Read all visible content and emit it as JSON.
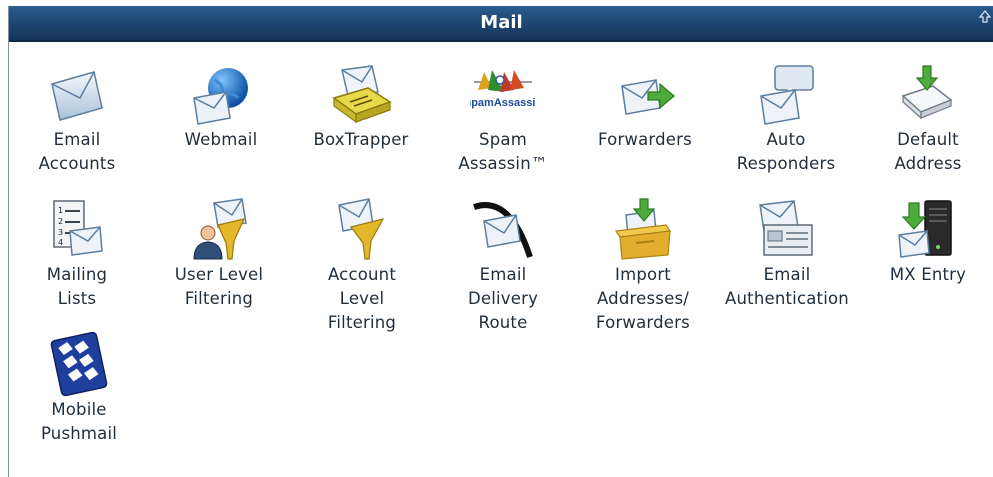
{
  "header": {
    "title": "Mail",
    "collapse_icon": "collapse-arrow-icon"
  },
  "items": [
    {
      "label": "Email\nAccounts",
      "icon": "envelope-icon"
    },
    {
      "label": "Webmail",
      "icon": "globe-envelope-icon"
    },
    {
      "label": "BoxTrapper",
      "icon": "box-trapper-icon"
    },
    {
      "label": "Spam\nAssassin™",
      "icon": "spamassassin-logo-icon",
      "logo_text": "SpamAssassin"
    },
    {
      "label": "Forwarders",
      "icon": "forward-envelope-icon"
    },
    {
      "label": "Auto\nResponders",
      "icon": "speech-bubble-envelope-icon"
    },
    {
      "label": "Default\nAddress",
      "icon": "download-envelope-icon"
    },
    {
      "label": "Mailing\nLists",
      "icon": "numbered-list-envelope-icon"
    },
    {
      "label": "User Level\nFiltering",
      "icon": "user-funnel-icon"
    },
    {
      "label": "Account\nLevel\nFiltering",
      "icon": "envelope-funnel-icon"
    },
    {
      "label": "Email\nDelivery\nRoute",
      "icon": "delivery-route-icon"
    },
    {
      "label": "Import\nAddresses/\nForwarders",
      "icon": "import-box-icon"
    },
    {
      "label": "Email\nAuthentication",
      "icon": "authentication-card-icon"
    },
    {
      "label": "MX Entry",
      "icon": "server-envelope-icon"
    },
    {
      "label": "Mobile\nPushmail",
      "icon": "mobile-pushmail-icon"
    }
  ]
}
